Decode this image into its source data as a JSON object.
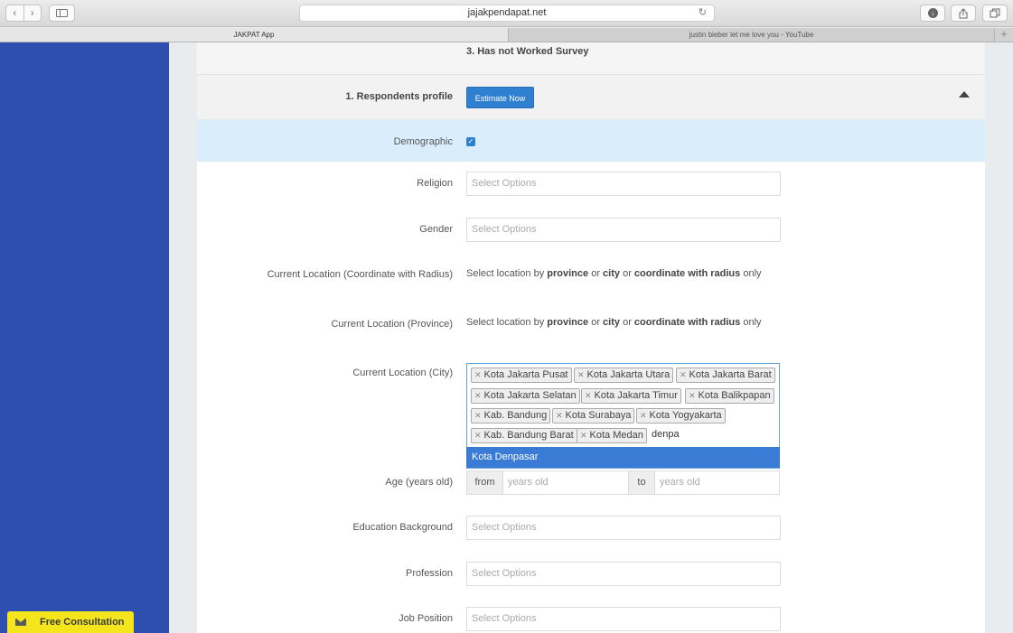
{
  "browser": {
    "url": "jajakpendapat.net",
    "tabs": [
      {
        "label": "JAKPAT App"
      },
      {
        "label": "justin bieber let me love you - YouTube"
      }
    ],
    "new_tab_symbol": "+"
  },
  "sidebar": {
    "free_consultation": "Free Consultation"
  },
  "form": {
    "top_item": "3. Has not Worked Survey",
    "section_title": "1. Respondents profile",
    "estimate_button": "Estimate Now",
    "demographic_label": "Demographic",
    "demographic_checked": true,
    "religion": {
      "label": "Religion",
      "placeholder": "Select Options"
    },
    "gender": {
      "label": "Gender",
      "placeholder": "Select Options"
    },
    "coordinate": {
      "label": "Current Location (Coordinate with Radius)",
      "text_1": "Select location by ",
      "bold_1": "province",
      "text_2": " or ",
      "bold_2": "city",
      "text_3": " or ",
      "bold_3": "coordinate with radius",
      "text_4": " only"
    },
    "province": {
      "label": "Current Location (Province)",
      "text_1": "Select location by ",
      "bold_1": "province",
      "text_2": " or ",
      "bold_2": "city",
      "text_3": " or ",
      "bold_3": "coordinate with radius",
      "text_4": " only"
    },
    "city": {
      "label": "Current Location (City)",
      "chips": [
        "Kota Jakarta Pusat",
        "Kota Jakarta Utara",
        "Kota Jakarta Barat",
        "Kota Jakarta Selatan",
        "Kota Jakarta Timur",
        "Kota Balikpapan",
        "Kab. Bandung",
        "Kota Surabaya",
        "Kota Yogyakarta",
        "Kab. Bandung Barat",
        "Kota Medan"
      ],
      "typed": "denpa",
      "suggestion": "Kota Denpasar"
    },
    "age": {
      "label": "Age (years old)",
      "from_label": "from",
      "to_label": "to",
      "placeholder": "years old"
    },
    "education": {
      "label": "Education Background",
      "placeholder": "Select Options"
    },
    "profession": {
      "label": "Profession",
      "placeholder": "Select Options"
    },
    "job_position": {
      "label": "Job Position",
      "placeholder": "Select Options"
    }
  },
  "colors": {
    "sidebar": "#2f4fb0",
    "accent": "#2f80d1",
    "demographic_band": "#d9eefa",
    "consultation": "#f5e51c"
  }
}
